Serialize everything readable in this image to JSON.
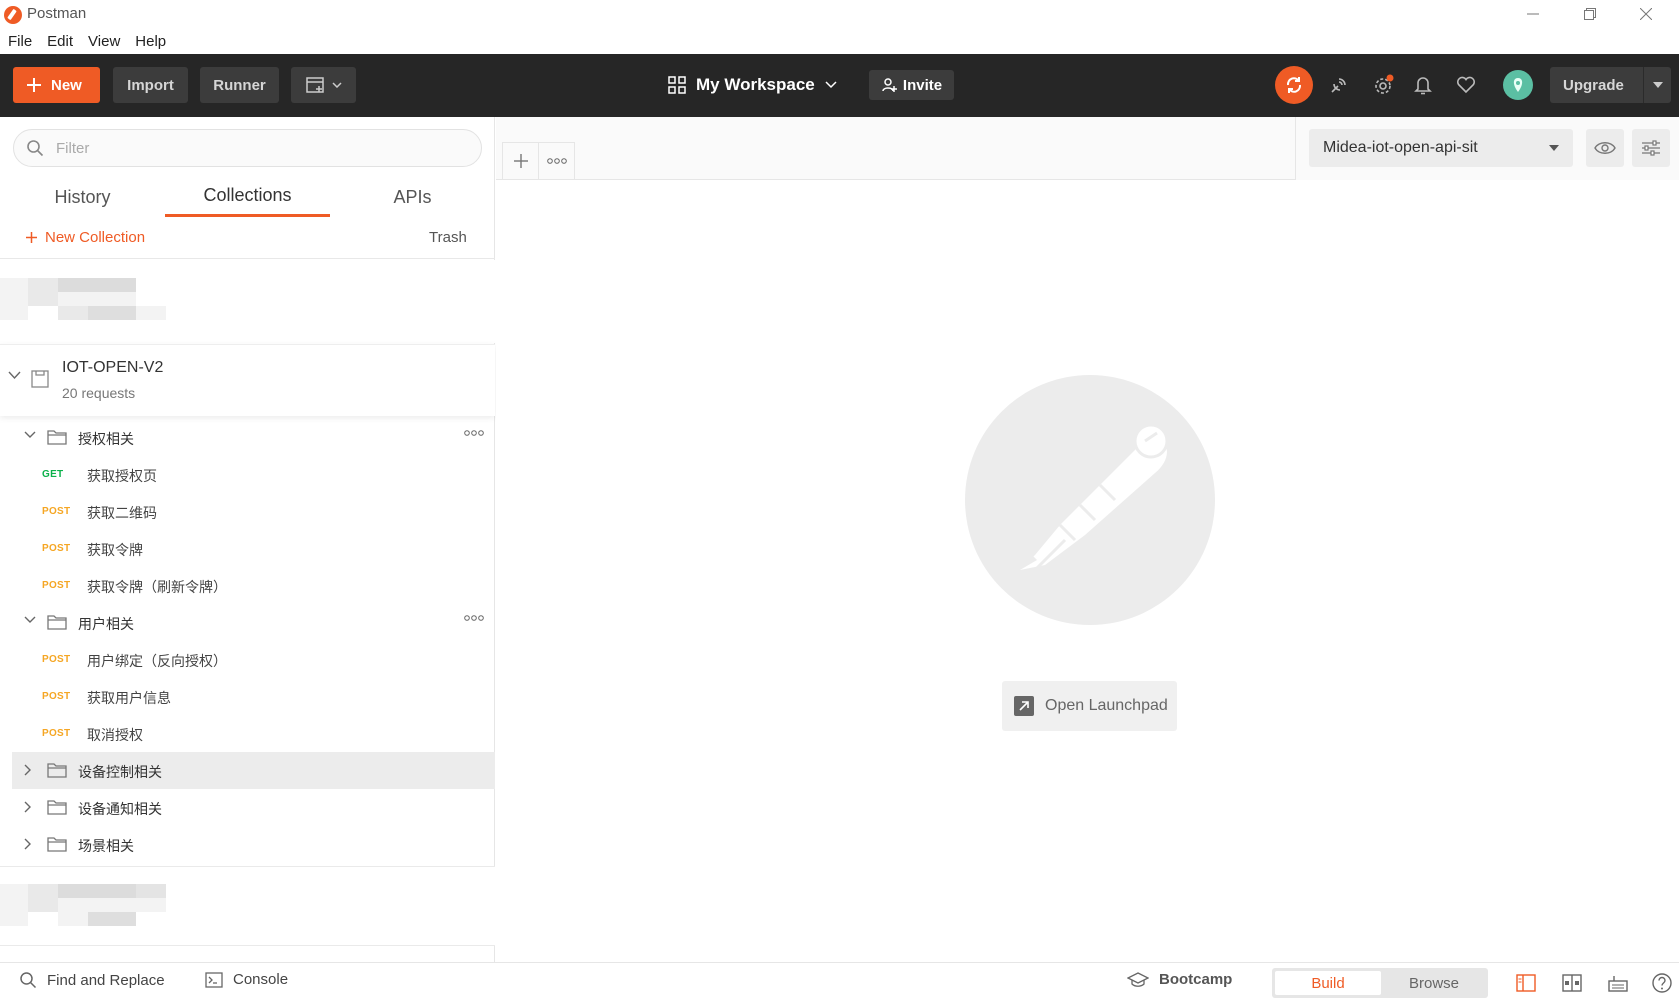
{
  "window": {
    "app_title": "Postman"
  },
  "menu": [
    "File",
    "Edit",
    "View",
    "Help"
  ],
  "header": {
    "new_label": "New",
    "import_label": "Import",
    "runner_label": "Runner",
    "workspace_label": "My Workspace",
    "invite_label": "Invite",
    "upgrade_label": "Upgrade"
  },
  "sidebar": {
    "filter_placeholder": "Filter",
    "tabs": [
      "History",
      "Collections",
      "APIs"
    ],
    "active_tab": "Collections",
    "new_collection_label": "New Collection",
    "trash_label": "Trash",
    "collection": {
      "name": "IOT-OPEN-V2",
      "count": "20 requests"
    },
    "folders": [
      {
        "name": "授权相关",
        "expanded": true,
        "requests": [
          {
            "method": "GET",
            "name": "获取授权页"
          },
          {
            "method": "POST",
            "name": "获取二维码"
          },
          {
            "method": "POST",
            "name": "获取令牌"
          },
          {
            "method": "POST",
            "name": "获取令牌（刷新令牌）"
          }
        ]
      },
      {
        "name": "用户相关",
        "expanded": true,
        "requests": [
          {
            "method": "POST",
            "name": "用户绑定（反向授权）"
          },
          {
            "method": "POST",
            "name": "获取用户信息"
          },
          {
            "method": "POST",
            "name": "取消授权"
          }
        ]
      },
      {
        "name": "设备控制相关",
        "expanded": false
      },
      {
        "name": "设备通知相关",
        "expanded": false
      },
      {
        "name": "场景相关",
        "expanded": false
      }
    ]
  },
  "environment": {
    "selected": "Midea-iot-open-api-sit"
  },
  "main": {
    "launchpad_label": "Open Launchpad"
  },
  "footer": {
    "find_replace_label": "Find and Replace",
    "console_label": "Console",
    "bootcamp_label": "Bootcamp",
    "build_label": "Build",
    "browse_label": "Browse"
  },
  "colors": {
    "accent": "#ef5b25",
    "header_bg": "#262626",
    "get": "#0cb14b",
    "post": "#f5a623"
  }
}
